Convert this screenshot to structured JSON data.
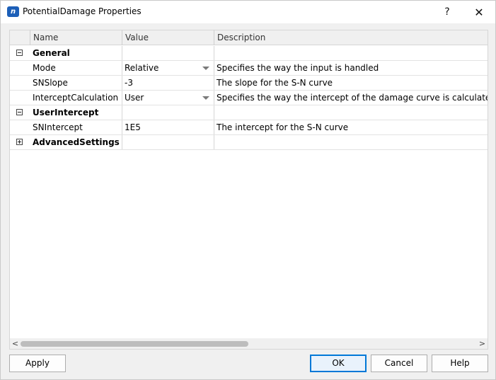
{
  "window": {
    "title": "PotentialDamage Properties",
    "app_icon_text": "n",
    "help_glyph": "?",
    "close_glyph": "✕"
  },
  "grid": {
    "columns": [
      "",
      "Name",
      "Value",
      "Description"
    ],
    "rows": [
      {
        "type": "group",
        "expander": "minus",
        "name": "General",
        "value": "",
        "description": ""
      },
      {
        "type": "prop",
        "name": "Mode",
        "value": "Relative",
        "dropdown": true,
        "description": "Specifies the way the input is handled"
      },
      {
        "type": "prop",
        "name": "SNSlope",
        "value": "-3",
        "dropdown": false,
        "description": "The slope for the S-N curve"
      },
      {
        "type": "prop",
        "name": "InterceptCalculation",
        "value": "User",
        "dropdown": true,
        "description": "Specifies the way the intercept of the damage curve is calculated"
      },
      {
        "type": "group",
        "expander": "minus",
        "name": "UserIntercept",
        "value": "",
        "description": ""
      },
      {
        "type": "prop",
        "name": "SNIntercept",
        "value": "1E5",
        "dropdown": false,
        "description": "The intercept for the S-N curve"
      },
      {
        "type": "group",
        "expander": "plus",
        "name": "AdvancedSettings",
        "value": "",
        "description": ""
      }
    ]
  },
  "scrollbar": {
    "left_arrow": "<",
    "right_arrow": ">"
  },
  "buttons": {
    "apply": "Apply",
    "ok": "OK",
    "cancel": "Cancel",
    "help": "Help"
  },
  "colors": {
    "accent": "#0078d7",
    "app_icon": "#1c5fb8"
  }
}
